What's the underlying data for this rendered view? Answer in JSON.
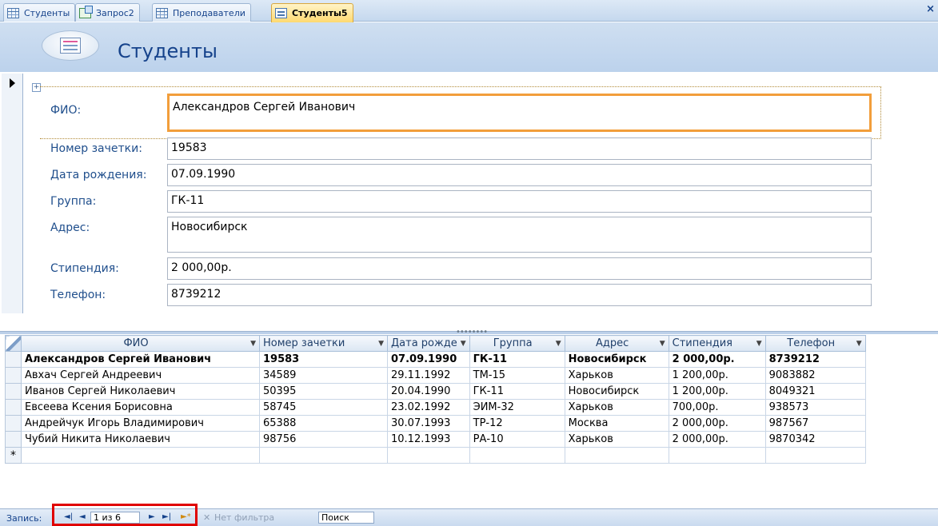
{
  "tabs": [
    {
      "label": "Студенты",
      "icon": "table-icon",
      "active": false
    },
    {
      "label": "Запрос2",
      "icon": "query-icon",
      "active": false
    },
    {
      "label": "Преподаватели",
      "icon": "table-icon",
      "active": false
    },
    {
      "label": "Студенты5",
      "icon": "form-icon",
      "active": true
    }
  ],
  "close_glyph": "×",
  "form": {
    "title": "Студенты",
    "layout_handle": "+",
    "fields": [
      {
        "label": "ФИО:",
        "value": "Александров Сергей Иванович"
      },
      {
        "label": "Номер зачетки:",
        "value": "19583"
      },
      {
        "label": "Дата рождения:",
        "value": "07.09.1990"
      },
      {
        "label": "Группа:",
        "value": "ГК-11"
      },
      {
        "label": "Адрес:",
        "value": "Новосибирск"
      },
      {
        "label": "Стипендия:",
        "value": "2 000,00р."
      },
      {
        "label": "Телефон:",
        "value": "8739212"
      }
    ]
  },
  "datasheet": {
    "columns": [
      "ФИО",
      "Номер зачетки",
      "Дата рожде",
      "Группа",
      "Адрес",
      "Стипендия",
      "Телефон"
    ],
    "rows": [
      [
        "Александров Сергей Иванович",
        "19583",
        "07.09.1990",
        "ГК-11",
        "Новосибирск",
        "2 000,00р.",
        "8739212"
      ],
      [
        "Авхач Сергей Андреевич",
        "34589",
        "29.11.1992",
        "ТМ-15",
        "Харьков",
        "1 200,00р.",
        "9083882"
      ],
      [
        "Иванов Сергей Николаевич",
        "50395",
        "20.04.1990",
        "ГК-11",
        "Новосибирск",
        "1 200,00р.",
        "8049321"
      ],
      [
        "Евсеева Ксения Борисовна",
        "58745",
        "23.02.1992",
        "ЭИМ-32",
        "Харьков",
        "700,00р.",
        "938573"
      ],
      [
        "Андрейчук Игорь Владимирович",
        "65388",
        "30.07.1993",
        "ТР-12",
        "Москва",
        "2 000,00р.",
        "987567"
      ],
      [
        "Чубий Никита Николаевич",
        "98756",
        "10.12.1993",
        "РА-10",
        "Харьков",
        "2 000,00р.",
        "9870342"
      ]
    ],
    "new_row_marker": "*"
  },
  "navigation": {
    "label": "Запись:",
    "first": "◄|",
    "prev": "◄",
    "position": "1 из 6",
    "next": "►",
    "last": "►|",
    "new": "►*",
    "filter_label": "Нет фильтра",
    "search_label": "Поиск"
  },
  "colors": {
    "accent_focus": "#f29e3b",
    "label_blue": "#1f4e8c",
    "title_blue": "#15428b",
    "highlight_red": "#e00000"
  }
}
